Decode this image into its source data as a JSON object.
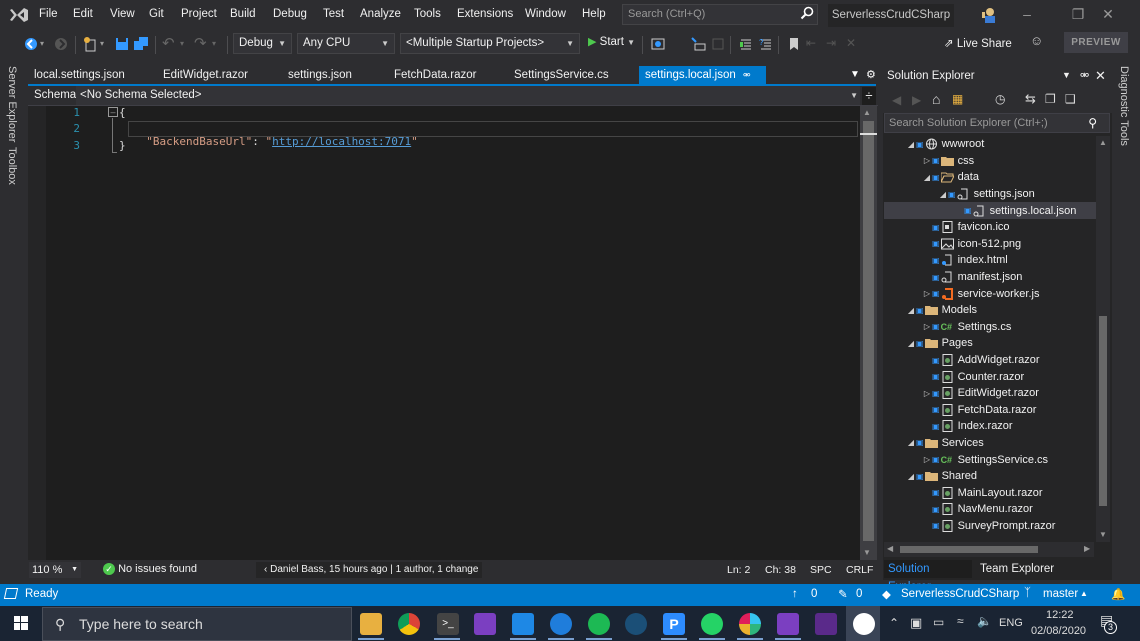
{
  "menubar": {
    "items": [
      "File",
      "Edit",
      "View",
      "Git",
      "Project",
      "Build",
      "Debug",
      "Test",
      "Analyze",
      "Tools",
      "Extensions",
      "Window",
      "Help"
    ],
    "search_placeholder": "Search (Ctrl+Q)",
    "solution_name": "ServerlessCrudCSharp"
  },
  "toolbar": {
    "config": "Debug",
    "platform": "Any CPU",
    "startup": "<Multiple Startup Projects>",
    "start_label": "Start",
    "live_share": "Live Share",
    "preview": "PREVIEW"
  },
  "left_rail": {
    "tabs": [
      "Server Explorer",
      "Toolbox"
    ]
  },
  "right_rail": {
    "tabs": [
      "Diagnostic Tools"
    ]
  },
  "doc_tabs": [
    {
      "label": "local.settings.json",
      "active": false
    },
    {
      "label": "EditWidget.razor",
      "active": false
    },
    {
      "label": "settings.json",
      "active": false
    },
    {
      "label": "FetchData.razor",
      "active": false
    },
    {
      "label": "SettingsService.cs",
      "active": false
    },
    {
      "label": "settings.local.json",
      "active": true
    }
  ],
  "schema": {
    "label": "Schema:",
    "value": "<No Schema Selected>"
  },
  "editor": {
    "line_numbers": [
      "1",
      "2",
      "3"
    ],
    "lines": {
      "l1": "{",
      "l2_key": "\"BackendBaseUrl\"",
      "l2_colon": ": ",
      "l2_quote_open": "\"",
      "l2_url": "http://localhost:7071",
      "l2_quote_close": "\"",
      "l3": "}"
    },
    "colors": {
      "key": "#d69d85",
      "link": "#569cd6",
      "punct": "#dcdcdc",
      "line_number": "#2b91af"
    }
  },
  "editor_status": {
    "zoom": "110 %",
    "issues": "No issues found",
    "codelens_author": "Daniel Bass, 15 hours ago",
    "codelens_changes": "1 author, 1 change",
    "line": "Ln: 2",
    "col": "Ch: 38",
    "indent": "SPC",
    "eol": "CRLF"
  },
  "solution_explorer": {
    "title": "Solution Explorer",
    "search_placeholder": "Search Solution Explorer (Ctrl+;)",
    "tree": [
      {
        "label": "wwwroot",
        "level": 0,
        "exp": "open",
        "icon": "globe"
      },
      {
        "label": "css",
        "level": 1,
        "exp": "closed",
        "icon": "folder"
      },
      {
        "label": "data",
        "level": 1,
        "exp": "open",
        "icon": "folder-open"
      },
      {
        "label": "settings.json",
        "level": 2,
        "exp": "open",
        "icon": "json"
      },
      {
        "label": "settings.local.json",
        "level": 3,
        "exp": "none",
        "icon": "json",
        "selected": true
      },
      {
        "label": "favicon.ico",
        "level": 1,
        "exp": "none",
        "icon": "ico"
      },
      {
        "label": "icon-512.png",
        "level": 1,
        "exp": "none",
        "icon": "image"
      },
      {
        "label": "index.html",
        "level": 1,
        "exp": "none",
        "icon": "html"
      },
      {
        "label": "manifest.json",
        "level": 1,
        "exp": "none",
        "icon": "json"
      },
      {
        "label": "service-worker.js",
        "level": 1,
        "exp": "closed",
        "icon": "js"
      },
      {
        "label": "Models",
        "level": 0,
        "exp": "open",
        "icon": "folder"
      },
      {
        "label": "Settings.cs",
        "level": 1,
        "exp": "closed",
        "icon": "cs"
      },
      {
        "label": "Pages",
        "level": 0,
        "exp": "open",
        "icon": "folder"
      },
      {
        "label": "AddWidget.razor",
        "level": 1,
        "exp": "none",
        "icon": "razor"
      },
      {
        "label": "Counter.razor",
        "level": 1,
        "exp": "none",
        "icon": "razor"
      },
      {
        "label": "EditWidget.razor",
        "level": 1,
        "exp": "closed",
        "icon": "razor"
      },
      {
        "label": "FetchData.razor",
        "level": 1,
        "exp": "none",
        "icon": "razor"
      },
      {
        "label": "Index.razor",
        "level": 1,
        "exp": "none",
        "icon": "razor"
      },
      {
        "label": "Services",
        "level": 0,
        "exp": "open",
        "icon": "folder"
      },
      {
        "label": "SettingsService.cs",
        "level": 1,
        "exp": "closed",
        "icon": "cs"
      },
      {
        "label": "Shared",
        "level": 0,
        "exp": "open",
        "icon": "folder"
      },
      {
        "label": "MainLayout.razor",
        "level": 1,
        "exp": "none",
        "icon": "razor"
      },
      {
        "label": "NavMenu.razor",
        "level": 1,
        "exp": "none",
        "icon": "razor"
      },
      {
        "label": "SurveyPrompt.razor",
        "level": 1,
        "exp": "none",
        "icon": "razor"
      }
    ],
    "bottom_tabs": [
      "Solution Explorer",
      "Team Explorer"
    ]
  },
  "statusbar": {
    "ready": "Ready",
    "push_count": "0",
    "edit_count": "0",
    "repo": "ServerlessCrudCSharp",
    "branch": "master"
  },
  "taskbar": {
    "search_placeholder": "Type here to search",
    "lang": "ENG",
    "time": "12:22",
    "date": "02/08/2020",
    "notification_count": "3"
  }
}
